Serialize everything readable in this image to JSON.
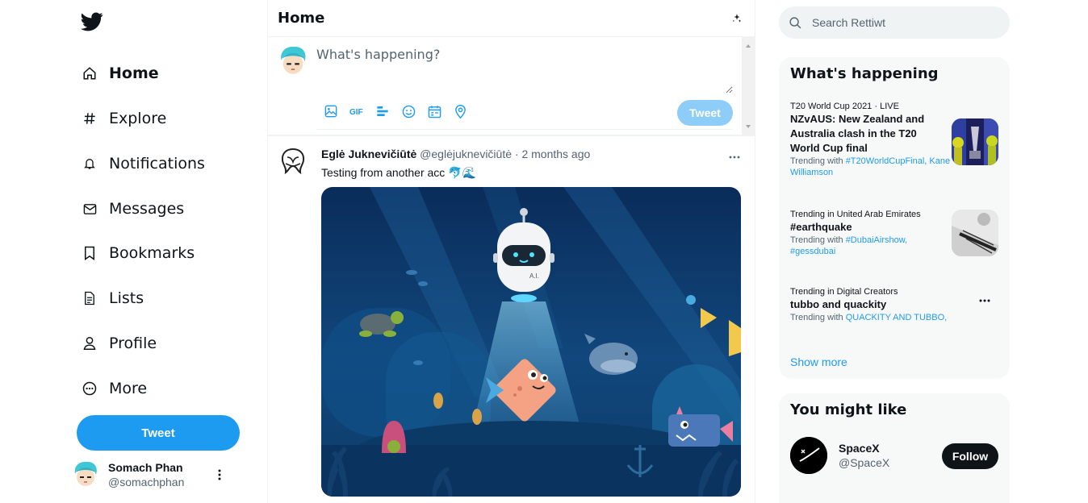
{
  "sidebar": {
    "items": [
      {
        "label": "Home",
        "icon": "home-icon"
      },
      {
        "label": "Explore",
        "icon": "hashtag-icon"
      },
      {
        "label": "Notifications",
        "icon": "bell-icon"
      },
      {
        "label": "Messages",
        "icon": "envelope-icon"
      },
      {
        "label": "Bookmarks",
        "icon": "bookmark-icon"
      },
      {
        "label": "Lists",
        "icon": "list-icon"
      },
      {
        "label": "Profile",
        "icon": "person-icon"
      },
      {
        "label": "More",
        "icon": "more-circle-icon"
      }
    ],
    "tweet_button": "Tweet",
    "user": {
      "name": "Somach Phan",
      "handle": "@somachphan"
    }
  },
  "main": {
    "title": "Home",
    "compose": {
      "placeholder": "What's happening?",
      "tweet_button": "Tweet"
    },
    "tweet": {
      "name": "Eglė Juknevičiūtė",
      "handle": "@eglėjuknevičiūtė",
      "time": "· 2 months ago",
      "text": "Testing from another acc 🐬🌊"
    }
  },
  "right": {
    "search_placeholder": "Search Rettiwt",
    "happening": {
      "title": "What's happening",
      "trends": [
        {
          "category": "T20 World Cup 2021 · LIVE",
          "title": "NZvAUS: New Zealand and Australia clash in the T20 World Cup final",
          "with_label": "Trending with ",
          "with_links": "#T20WorldCupFinal, Kane Williamson"
        },
        {
          "category": "Trending in United Arab Emirates",
          "title": "#earthquake",
          "with_label": "Trending with ",
          "with_links": "#DubaiAirshow, #gessdubai"
        },
        {
          "category": "Trending in Digital Creators",
          "title": "tubbo and quackity",
          "with_label": "Trending with ",
          "with_links": "QUACKITY AND TUBBO,"
        }
      ],
      "show_more": "Show more"
    },
    "you_might_like": {
      "title": "You might like",
      "accounts": [
        {
          "name": "SpaceX",
          "handle": "@SpaceX",
          "button": "Follow"
        }
      ]
    }
  },
  "colors": {
    "accent": "#1d9bf0",
    "accent_disabled": "#8ecdf8",
    "panel_bg": "#f7f9f9",
    "text": "#0f1419",
    "muted": "#536471"
  }
}
